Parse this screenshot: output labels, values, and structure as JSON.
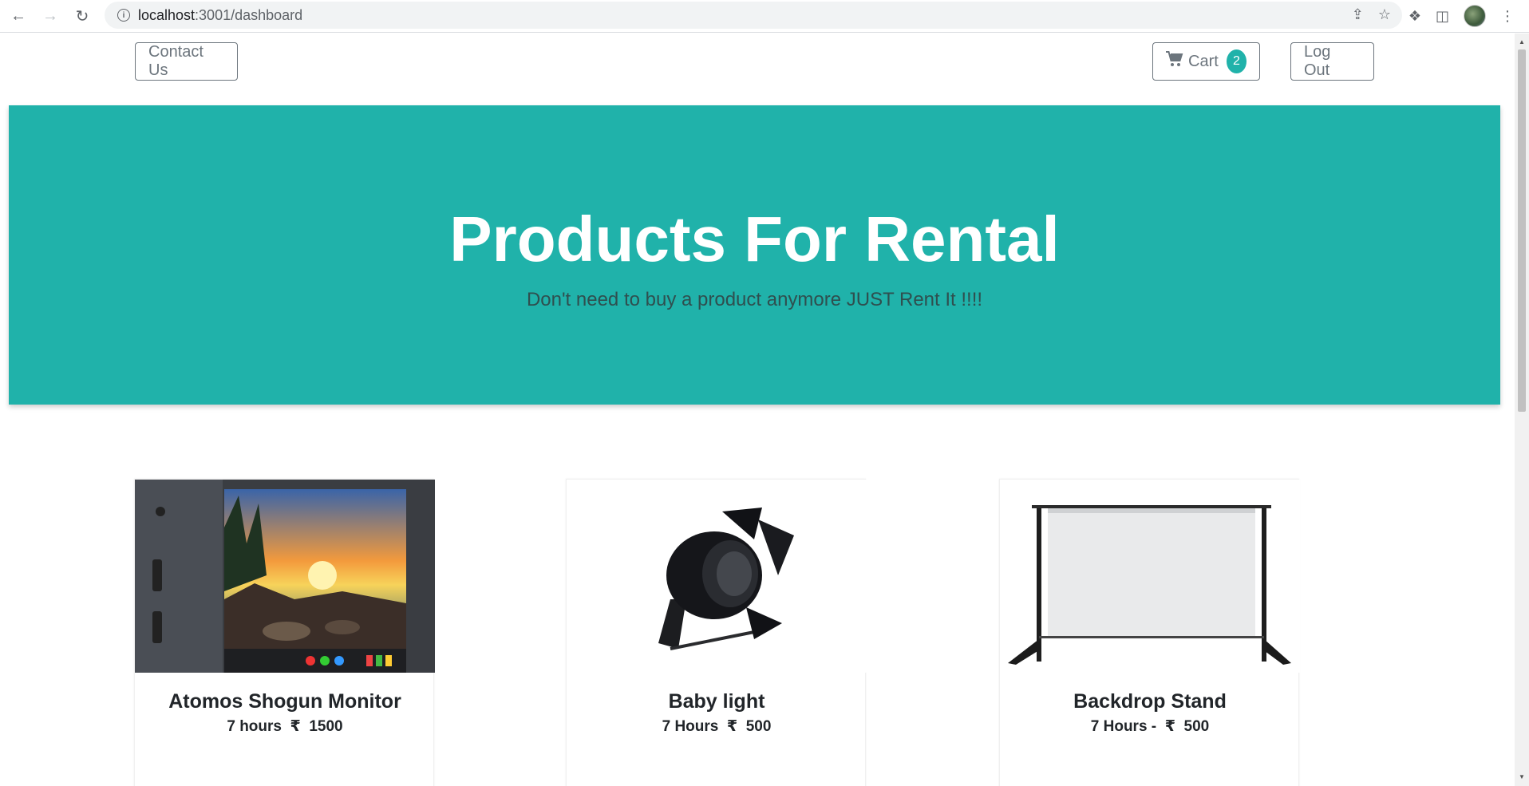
{
  "browser": {
    "url_host": "localhost",
    "url_port_path": ":3001/dashboard"
  },
  "nav": {
    "contact_label": "Contact Us",
    "cart_label": "Cart",
    "cart_count": "2",
    "logout_label": "Log Out"
  },
  "hero": {
    "title": "Products For Rental",
    "subtitle": "Don't need to buy a product anymore JUST Rent It !!!!",
    "color": "#20b2aa"
  },
  "products": [
    {
      "name": "Atomos Shogun Monitor",
      "price_prefix": "7 hours",
      "currency": "₹",
      "price": "1500"
    },
    {
      "name": "Baby light",
      "price_prefix": "7 Hours",
      "currency": "₹",
      "price": "500"
    },
    {
      "name": "Backdrop Stand",
      "price_prefix": "7 Hours -",
      "currency": "₹",
      "price": "500"
    }
  ]
}
